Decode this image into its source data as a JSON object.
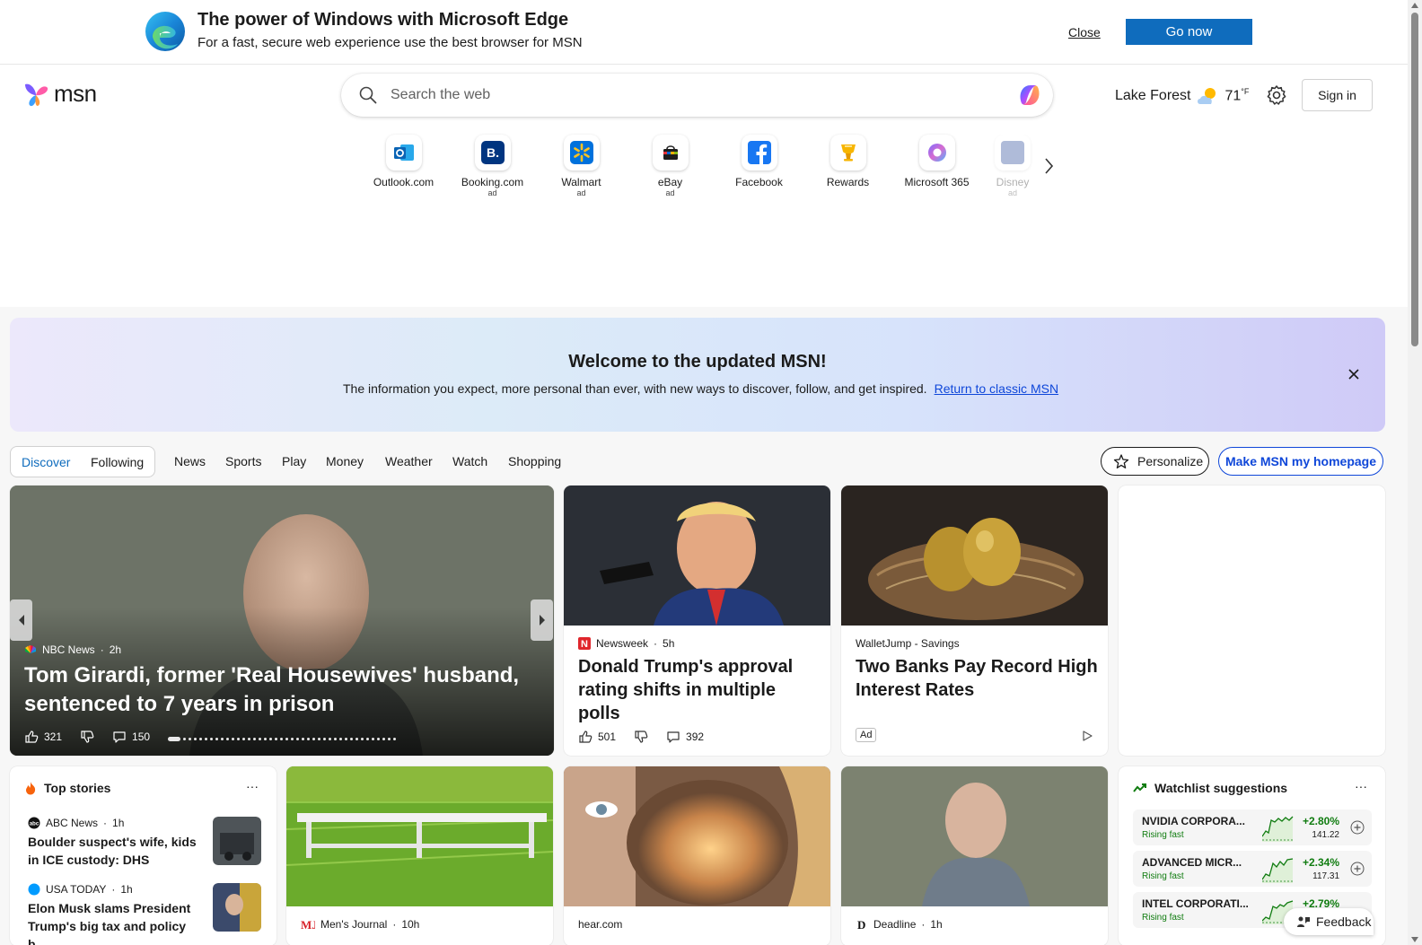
{
  "promo": {
    "title": "The power of Windows with Microsoft Edge",
    "subtitle": "For a fast, secure web experience use the best browser for MSN",
    "close_label": "Close",
    "cta_label": "Go now"
  },
  "header": {
    "logo_text": "msn",
    "search_placeholder": "Search the web",
    "weather_location": "Lake Forest",
    "weather_temp": "71",
    "weather_unit": "°F",
    "signin_label": "Sign in"
  },
  "tiles": [
    {
      "label": "Outlook.com",
      "ad": "",
      "icon": "outlook-icon"
    },
    {
      "label": "Booking.com",
      "ad": "ad",
      "icon": "booking-icon"
    },
    {
      "label": "Walmart",
      "ad": "ad",
      "icon": "walmart-icon"
    },
    {
      "label": "eBay",
      "ad": "ad",
      "icon": "ebay-icon"
    },
    {
      "label": "Facebook",
      "ad": "",
      "icon": "facebook-icon"
    },
    {
      "label": "Rewards",
      "ad": "",
      "icon": "rewards-icon"
    },
    {
      "label": "Microsoft 365",
      "ad": "",
      "icon": "microsoft-365-icon"
    },
    {
      "label": "Disney",
      "ad": "ad",
      "icon": "disney-icon"
    }
  ],
  "welcome": {
    "title": "Welcome to the updated MSN!",
    "body": "The information you expect, more personal than ever, with new ways to discover, follow, and get inspired.",
    "link": "Return to classic MSN"
  },
  "nav": {
    "discover": "Discover",
    "following": "Following",
    "items": [
      "News",
      "Sports",
      "Play",
      "Money",
      "Weather",
      "Watch",
      "Shopping"
    ],
    "personalize": "Personalize",
    "make_homepage": "Make MSN my homepage"
  },
  "hero": {
    "source": "NBC News",
    "age": "2h",
    "title": "Tom Girardi, former 'Real Housewives' husband, sentenced to 7 years in prison",
    "likes": "321",
    "comments": "150"
  },
  "cards": [
    {
      "source": "Newsweek",
      "age": "5h",
      "title": "Donald Trump's approval rating shifts in multiple polls",
      "likes": "501",
      "comments": "392"
    },
    {
      "source": "WalletJump - Savings",
      "title": "Two Banks Pay Record High Interest Rates",
      "ad_label": "Ad"
    }
  ],
  "top_stories": {
    "heading": "Top stories",
    "more": "···",
    "items": [
      {
        "source": "ABC News",
        "age": "1h",
        "title": "Boulder suspect's wife, kids in ICE custody: DHS"
      },
      {
        "source": "USA TODAY",
        "age": "1h",
        "title": "Elon Musk slams President Trump's big tax and policy b..."
      }
    ]
  },
  "bottom_cards": [
    {
      "source": "Men's Journal",
      "age": "10h"
    },
    {
      "source": "hear.com",
      "age": ""
    },
    {
      "source": "Deadline",
      "age": "1h"
    }
  ],
  "watchlist": {
    "heading": "Watchlist suggestions",
    "more": "···",
    "items": [
      {
        "name": "NVIDIA CORPORA...",
        "status": "Rising fast",
        "change": "+2.80%",
        "price": "141.22"
      },
      {
        "name": "ADVANCED MICR...",
        "status": "Rising fast",
        "change": "+2.34%",
        "price": "117.31"
      },
      {
        "name": "INTEL CORPORATI...",
        "status": "Rising fast",
        "change": "+2.79%",
        "price": ""
      }
    ]
  },
  "feedback_label": "Feedback",
  "colors": {
    "accent": "#0f6cbd",
    "link": "#0f47d9",
    "positive": "#107c10"
  }
}
